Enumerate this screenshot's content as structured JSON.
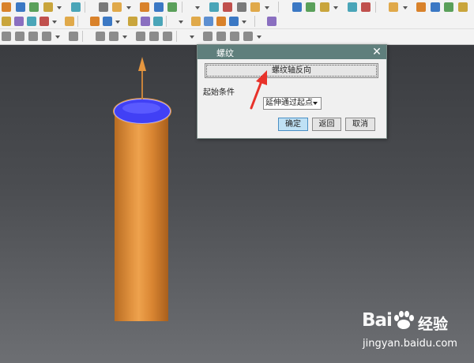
{
  "dialog": {
    "title": "螺纹",
    "reverse_button": "螺纹轴反向",
    "start_condition_label": "起始条件",
    "start_condition_value": "延伸通过起点",
    "ok_button": "确定",
    "back_button": "返回",
    "cancel_button": "取消",
    "close_glyph": "✕"
  },
  "watermark": {
    "logo": "Bai",
    "logo_suffix": "经验",
    "url": "jingyan.baidu.com"
  },
  "colors": {
    "dialog_titlebar": "#5f7f7c",
    "cylinder": "#e0913e",
    "cylinder_top_face": "#4140f5",
    "annotation_arrow": "#e8322a",
    "ok_button": "#bfe1f5"
  },
  "icons": [
    "toolbar-icon",
    "close-icon",
    "dropdown-arrow-icon",
    "annotation-arrow-icon",
    "baidu-paw-icon"
  ]
}
